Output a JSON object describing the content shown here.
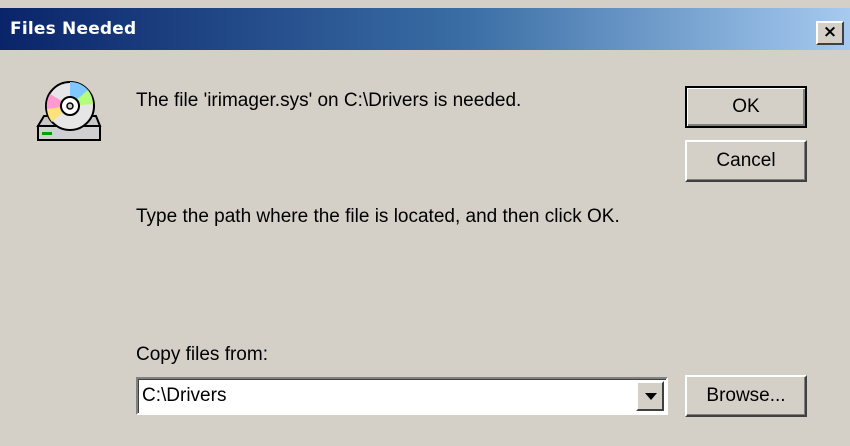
{
  "window": {
    "title": "Files Needed",
    "close_label": "×"
  },
  "icons": {
    "cd": "cd-drive-icon",
    "close": "close-icon",
    "dropdown": "chevron-down-icon"
  },
  "message": {
    "line1": "The file 'irimager.sys' on C:\\Drivers is needed.",
    "line2": "Type the path where the file is located, and then click OK."
  },
  "buttons": {
    "ok": "OK",
    "cancel": "Cancel",
    "browse": "Browse..."
  },
  "copy_from": {
    "label": "Copy files from:",
    "value": "C:\\Drivers"
  },
  "colors": {
    "title_gradient_start": "#0a246a",
    "title_gradient_end": "#a6caf0",
    "dialog_bg": "#d4d0c8"
  }
}
